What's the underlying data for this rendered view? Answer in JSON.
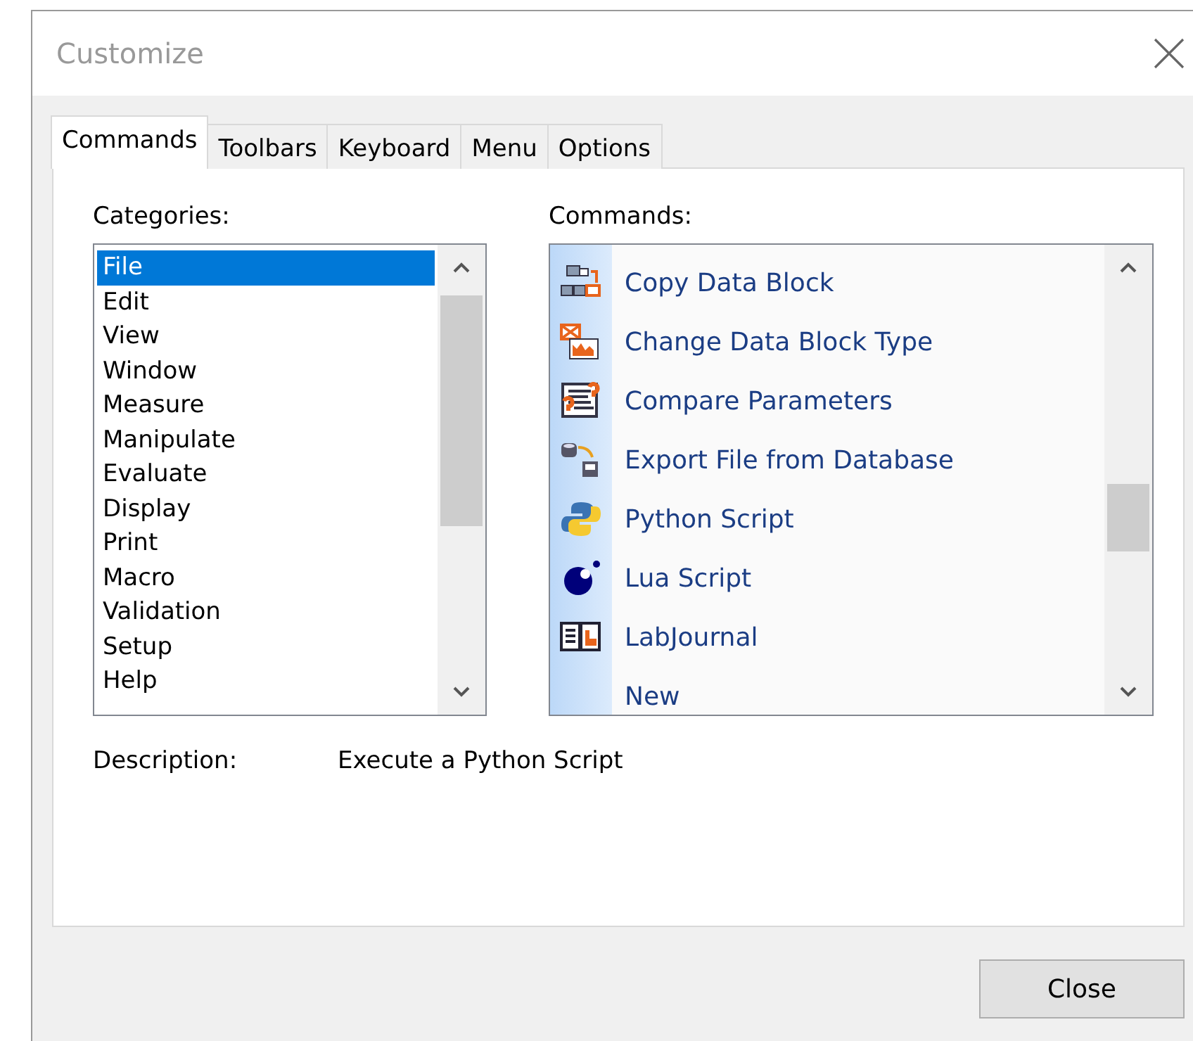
{
  "window": {
    "title": "Customize"
  },
  "tabs": [
    {
      "label": "Commands",
      "selected": true
    },
    {
      "label": "Toolbars",
      "selected": false
    },
    {
      "label": "Keyboard",
      "selected": false
    },
    {
      "label": "Menu",
      "selected": false
    },
    {
      "label": "Options",
      "selected": false
    }
  ],
  "categories": {
    "label": "Categories:",
    "items": [
      {
        "label": "File",
        "selected": true
      },
      {
        "label": "Edit",
        "selected": false
      },
      {
        "label": "View",
        "selected": false
      },
      {
        "label": "Window",
        "selected": false
      },
      {
        "label": "Measure",
        "selected": false
      },
      {
        "label": "Manipulate",
        "selected": false
      },
      {
        "label": "Evaluate",
        "selected": false
      },
      {
        "label": "Display",
        "selected": false
      },
      {
        "label": "Print",
        "selected": false
      },
      {
        "label": "Macro",
        "selected": false
      },
      {
        "label": "Validation",
        "selected": false
      },
      {
        "label": "Setup",
        "selected": false
      },
      {
        "label": "Help",
        "selected": false
      }
    ]
  },
  "commands": {
    "label": "Commands:",
    "items": [
      {
        "label": "Copy Data Block",
        "kind": "copy"
      },
      {
        "label": "Change Data Block Type",
        "kind": "change"
      },
      {
        "label": "Compare Parameters",
        "kind": "compare"
      },
      {
        "label": "Export File from Database",
        "kind": "export"
      },
      {
        "label": "Python Script",
        "kind": "python"
      },
      {
        "label": "Lua Script",
        "kind": "lua"
      },
      {
        "label": "LabJournal",
        "kind": "journal"
      },
      {
        "label": "New",
        "kind": "none"
      }
    ]
  },
  "description": {
    "label": "Description:",
    "value": "Execute a Python Script"
  },
  "buttons": [
    "Close"
  ]
}
